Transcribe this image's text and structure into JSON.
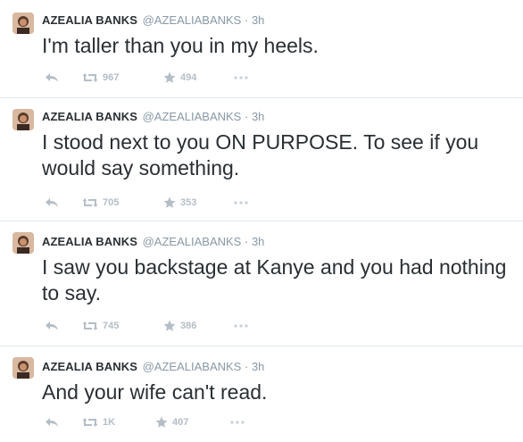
{
  "tweets": [
    {
      "fullname": "AZEALIA BANKS",
      "username": "@AZEALIABANKS",
      "separator": "·",
      "time": "3h",
      "text": "I'm taller than you in my heels.",
      "retweets": "967",
      "favorites": "494"
    },
    {
      "fullname": "AZEALIA BANKS",
      "username": "@AZEALIABANKS",
      "separator": "·",
      "time": "3h",
      "text": "I stood next to you ON PURPOSE. To see if you would say something.",
      "retweets": "705",
      "favorites": "353"
    },
    {
      "fullname": "AZEALIA BANKS",
      "username": "@AZEALIABANKS",
      "separator": "·",
      "time": "3h",
      "text": "I saw you backstage at Kanye and you had nothing to say.",
      "retweets": "745",
      "favorites": "386"
    },
    {
      "fullname": "AZEALIA BANKS",
      "username": "@AZEALIABANKS",
      "separator": "·",
      "time": "3h",
      "text": "And your wife can't read.",
      "retweets": "1K",
      "favorites": "407"
    }
  ],
  "icons": {
    "reply": "reply-icon",
    "retweet": "retweet-icon",
    "favorite": "star-icon",
    "more": "more-icon"
  },
  "colors": {
    "text": "#292f33",
    "meta": "#8899a6",
    "action": "#b4bec6",
    "divider": "#e1e8ed"
  }
}
